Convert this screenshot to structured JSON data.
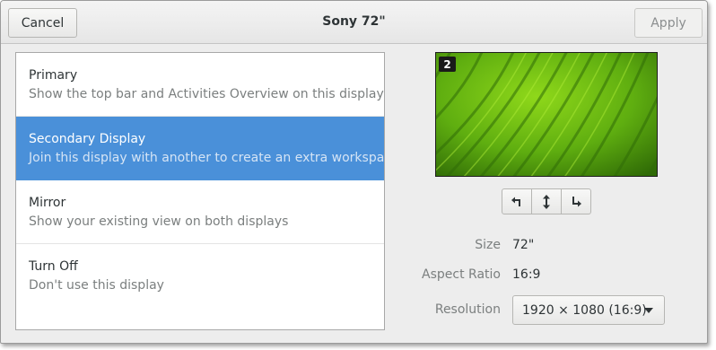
{
  "header": {
    "title": "Sony 72\"",
    "cancel_label": "Cancel",
    "apply_label": "Apply"
  },
  "modes": [
    {
      "title": "Primary",
      "description": "Show the top bar and Activities Overview on this display",
      "selected": false
    },
    {
      "title": "Secondary Display",
      "description": "Join this display with another to create an extra workspace",
      "selected": true
    },
    {
      "title": "Mirror",
      "description": "Show your existing view on both displays",
      "selected": false
    },
    {
      "title": "Turn Off",
      "description": "Don't use this display",
      "selected": false
    }
  ],
  "preview": {
    "display_number": "2"
  },
  "rotation": {
    "icons": [
      "rotate-left-icon",
      "flip-vertical-icon",
      "rotate-right-icon"
    ]
  },
  "details": {
    "size_label": "Size",
    "size_value": "72\"",
    "aspect_label": "Aspect Ratio",
    "aspect_value": "16:9",
    "resolution_label": "Resolution",
    "resolution_value": "1920 × 1080 (16:9)"
  },
  "colors": {
    "accent": "#4a90d9",
    "window_bg": "#ededed"
  }
}
